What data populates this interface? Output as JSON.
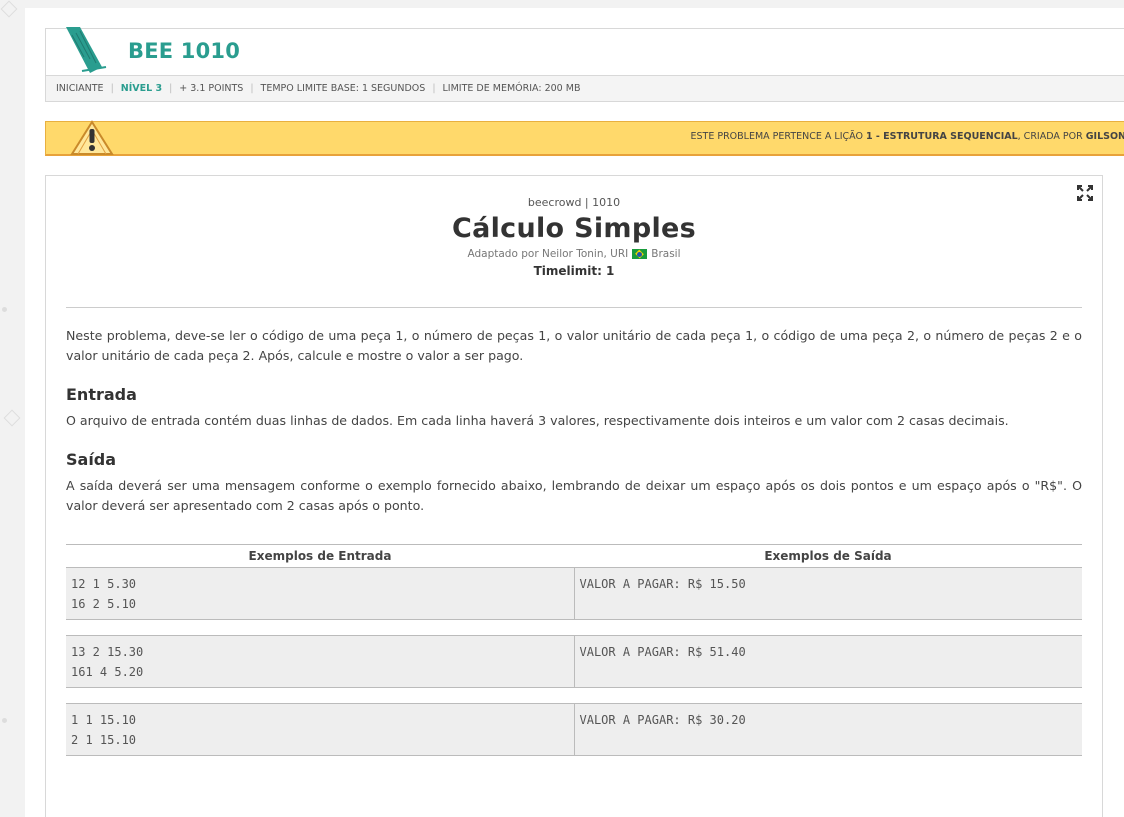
{
  "problem": {
    "code": "BEE 1010",
    "meta": {
      "category": "INICIANTE",
      "level": "NÍVEL 3",
      "points": "+ 3.1 POINTS",
      "time_limit": "TEMPO LIMITE BASE: 1 SEGUNDOS",
      "memory_limit": "LIMITE DE MEMÓRIA: 200 MB"
    }
  },
  "warning": {
    "prefix": "ESTE PROBLEMA PERTENCE A LIÇÃO",
    "lesson": "1 - ESTRUTURA SEQUENCIAL",
    "suffix": ", CRIADA POR",
    "author": "GILSON"
  },
  "statement": {
    "source": "beecrowd | 1010",
    "title": "Cálculo Simples",
    "author_prefix": "Adaptado por Neilor Tonin, URI",
    "country": "Brasil",
    "timelimit": "Timelimit: 1",
    "description": "Neste problema, deve-se ler o código de uma peça 1, o número de peças 1, o valor unitário de cada peça 1, o código de uma peça 2, o número de peças 2 e o valor unitário de cada peça 2. Após, calcule e mostre o valor a ser pago.",
    "input_title": "Entrada",
    "input_text": "O arquivo de entrada contém duas linhas de dados. Em cada linha haverá 3 valores, respectivamente dois inteiros e um valor com 2 casas decimais.",
    "output_title": "Saída",
    "output_text": "A saída deverá ser uma mensagem conforme o exemplo fornecido abaixo, lembrando de deixar um espaço após os dois pontos e um espaço após o \"R$\". O valor deverá ser apresentado com 2 casas após o ponto."
  },
  "examples": {
    "input_header": "Exemplos de Entrada",
    "output_header": "Exemplos de Saída",
    "rows": [
      {
        "input": "12 1 5.30\n16 2 5.10",
        "output": "VALOR A PAGAR: R$ 15.50"
      },
      {
        "input": "13 2 15.30\n161 4 5.20",
        "output": "VALOR A PAGAR: R$ 51.40"
      },
      {
        "input": "1 1 15.10\n2 1 15.10",
        "output": "VALOR A PAGAR: R$ 30.20"
      }
    ]
  },
  "icons": {
    "logo": "beecrowd-logo",
    "warning": "warning-icon",
    "fullscreen": "expand-icon"
  },
  "colors": {
    "accent": "#2a9d8f",
    "warning_bg": "#ffd96b",
    "example_bg": "#eeeeee"
  }
}
